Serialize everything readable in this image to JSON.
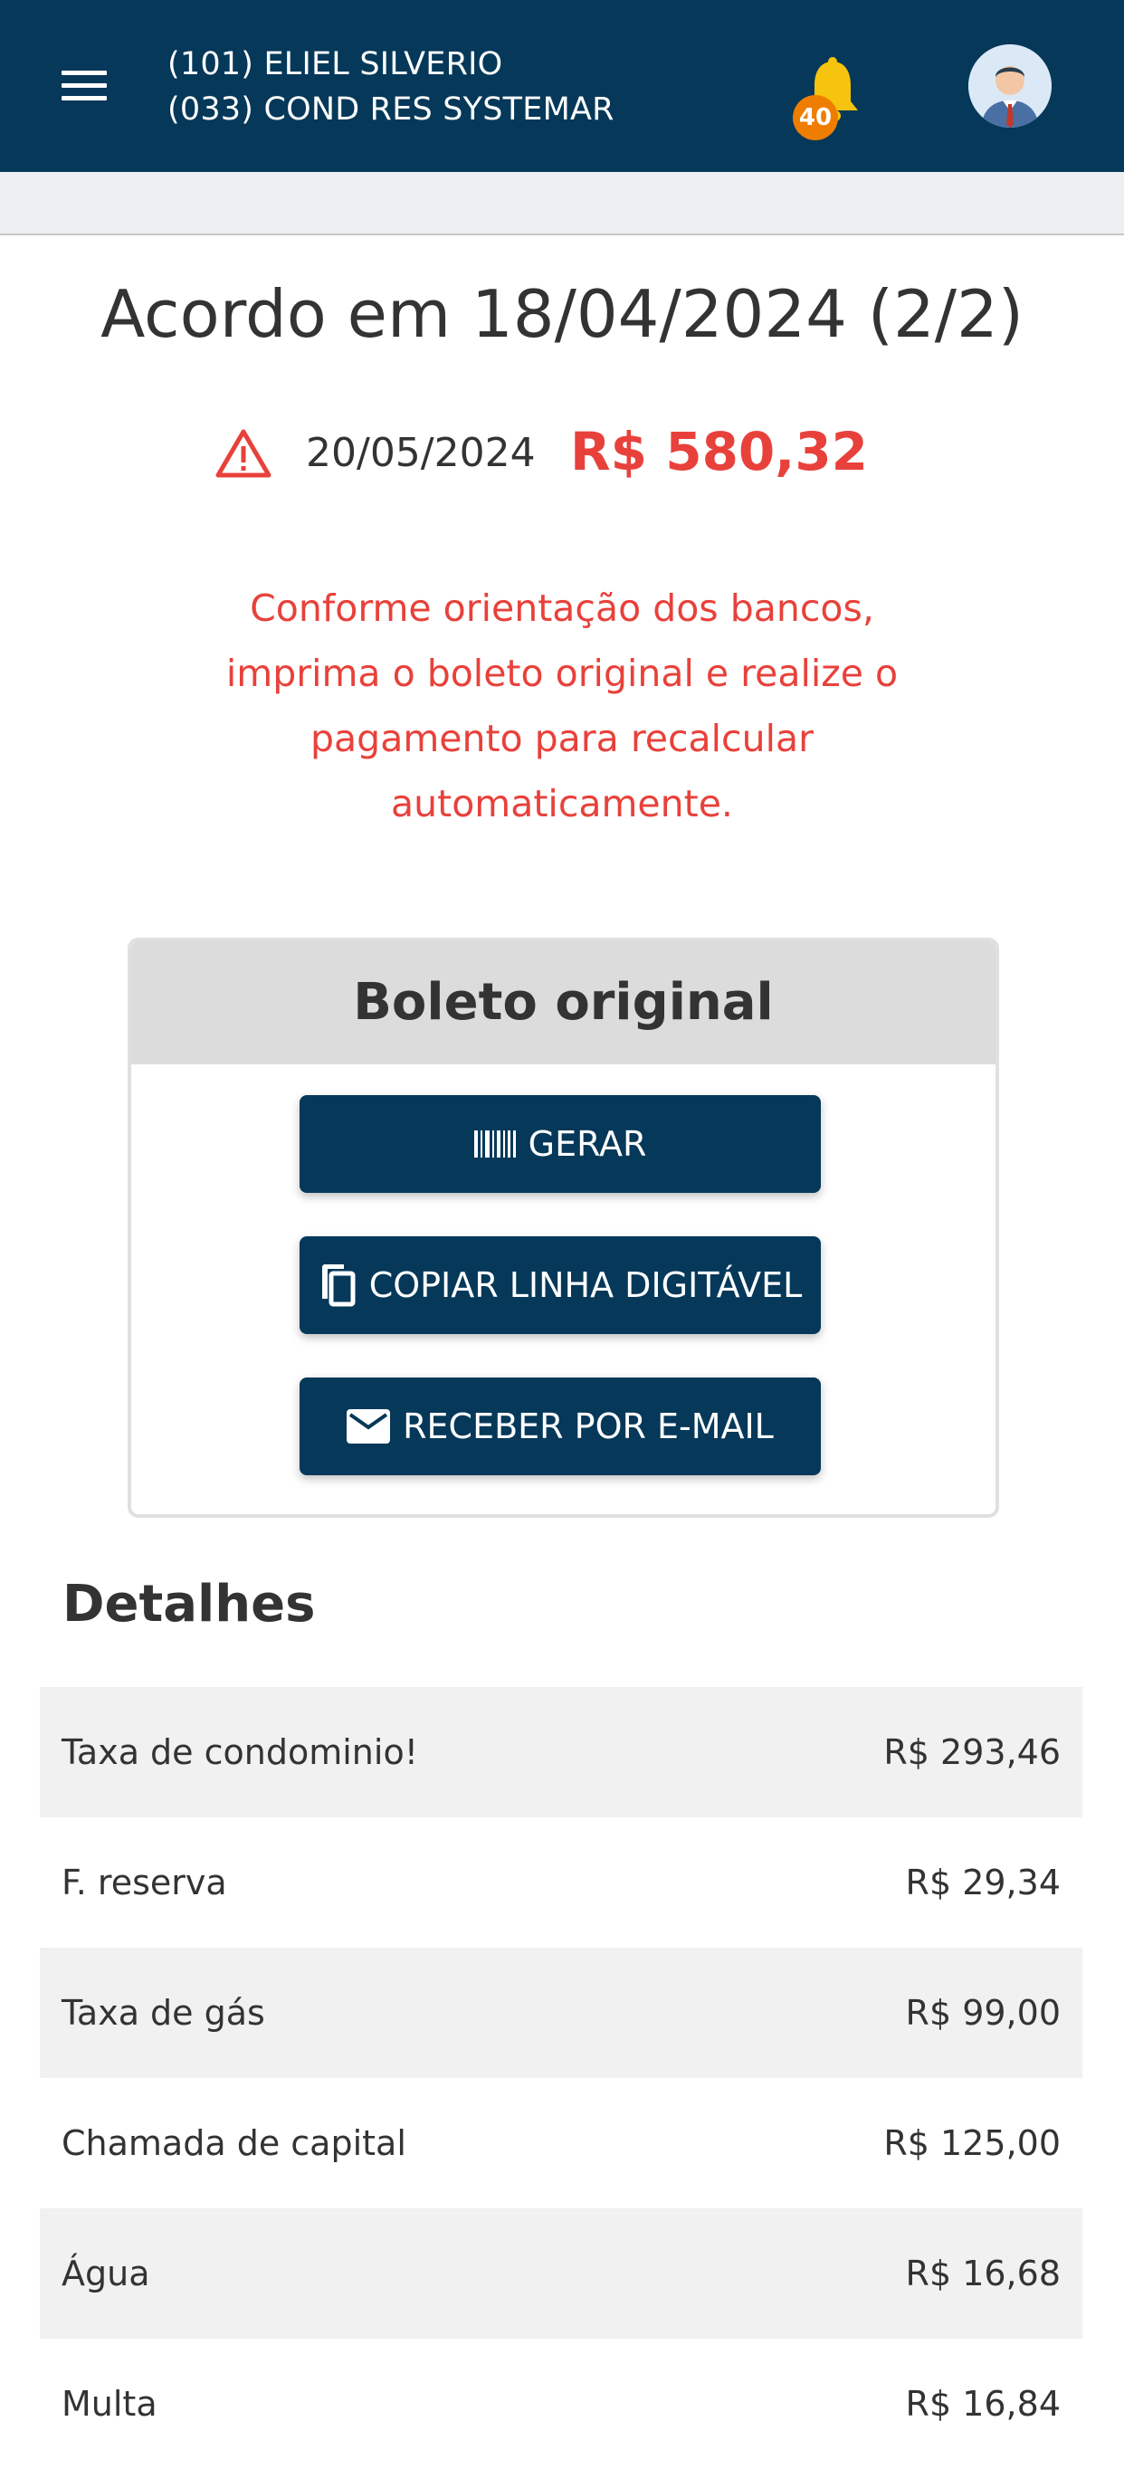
{
  "header": {
    "unit_line": "(101) ELIEL SILVERIO",
    "condo_line": "(033) COND RES SYSTEMAR",
    "notification_count": "40",
    "menu_icon": "hamburger-menu-icon",
    "bell_icon": "bell-icon",
    "avatar_icon": "user-avatar"
  },
  "agreement": {
    "title": "Acordo em 18/04/2024 (2/2)",
    "due_date": "20/05/2024",
    "amount": "R$ 580,32",
    "warning_icon": "warning-triangle-icon",
    "notice": "Conforme orientação dos bancos, imprima o boleto original e realize o pagamento para recalcular automaticamente."
  },
  "boleto": {
    "title": "Boleto original",
    "buttons": [
      {
        "label": "GERAR",
        "icon": "barcode-icon"
      },
      {
        "label": "COPIAR LINHA DIGITÁVEL",
        "icon": "copy-icon"
      },
      {
        "label": "RECEBER POR E-MAIL",
        "icon": "mail-icon"
      }
    ]
  },
  "details": {
    "title": "Detalhes",
    "rows": [
      {
        "label": "Taxa de condominio!",
        "value": "R$ 293,46"
      },
      {
        "label": "F. reserva",
        "value": "R$ 29,34"
      },
      {
        "label": "Taxa de gás",
        "value": "R$ 99,00"
      },
      {
        "label": "Chamada de capital",
        "value": "R$ 125,00"
      },
      {
        "label": "Água",
        "value": "R$ 16,68"
      },
      {
        "label": "Multa",
        "value": "R$ 16,84"
      }
    ]
  },
  "colors": {
    "primary": "#053859",
    "alert": "#e8413b",
    "badge": "#ef7d00",
    "row_alt": "#f1f1f1"
  }
}
